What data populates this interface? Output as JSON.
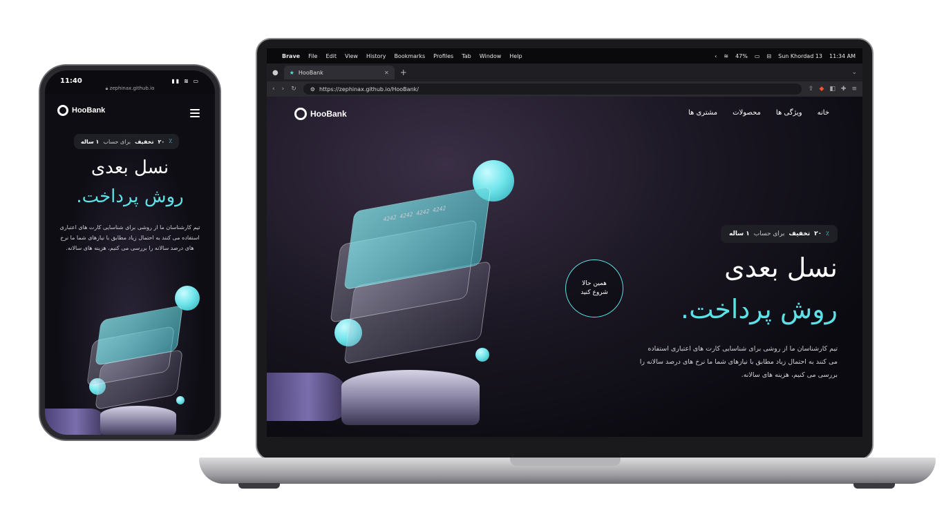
{
  "macos_menubar": {
    "app": "Brave",
    "menus": [
      "File",
      "Edit",
      "View",
      "History",
      "Bookmarks",
      "Profiles",
      "Tab",
      "Window",
      "Help"
    ],
    "battery": "47%",
    "date": "Sun Khordad 13",
    "time": "11:34 AM"
  },
  "browser": {
    "tab_title": "HooBank",
    "url": "https://zephinax.github.io/HooBank/"
  },
  "site": {
    "brand": "HooBank",
    "nav": [
      "خانه",
      "ویژگی ها",
      "محصولات",
      "مشتری ها"
    ],
    "promo": {
      "percent": "٪",
      "number": "۲۰",
      "bold": "تخفیف",
      "text_mid": "برای حساب",
      "bold_end": "۱ ساله"
    },
    "headline_1": "نسل بعدی",
    "headline_2": "روش پرداخت.",
    "description": "تیم کارشناسان ما از روشی برای شناسایی کارت های اعتباری استفاده می کنند به احتمال زیاد مطابق با نیازهای شما ما نرخ های درصد سالانه را بررسی می کنیم، هزینه های سالانه.",
    "cta_line1": "همین حالا",
    "cta_line2": "شروع کنید",
    "card_number": "4242 4242 4242 4242"
  },
  "phone": {
    "time": "11:40",
    "url": "zephinax.github.io"
  },
  "colors": {
    "accent": "#5ce1e6",
    "background": "#0b0b10"
  }
}
